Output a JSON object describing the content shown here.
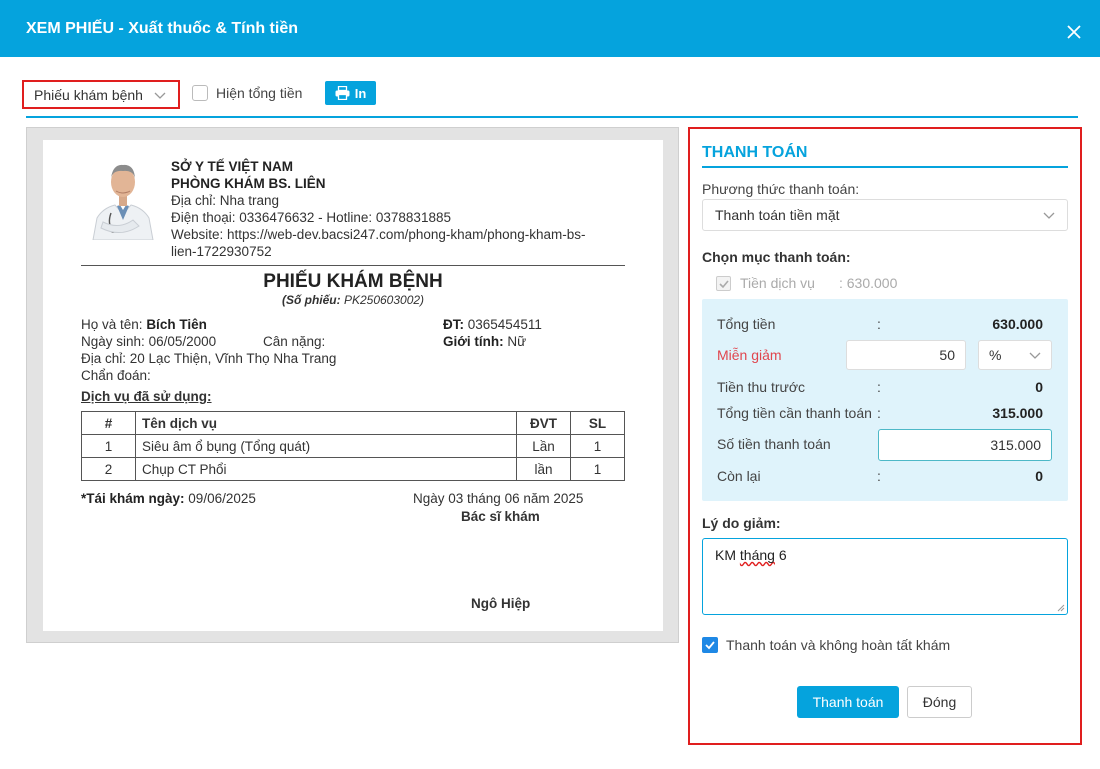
{
  "window": {
    "title": "XEM PHIẾU - Xuất thuốc & Tính tiền",
    "close_icon": "close-icon"
  },
  "toolbar": {
    "form_select": "Phiếu khám bệnh",
    "show_total_label": "Hiện tổng tiền",
    "show_total_checked": false,
    "print_label": "In"
  },
  "document": {
    "org": "SỞ Y TẾ VIỆT NAM",
    "clinic_name": "PHÒNG KHÁM BS. LIÊN",
    "address": "Địa chỉ: Nha trang",
    "phone": "Điện thoại: 0336476632 - Hotline: 0378831885",
    "website_line1": "Website: https://web-dev.bacsi247.com/phong-kham/phong-kham-bs-",
    "website_line2": "lien-1722930752",
    "title": "PHIẾU KHÁM BỆNH",
    "code_label": "(Số phiếu:",
    "code_value": "PK250603002)",
    "patient": {
      "name_label": "Họ và tên:",
      "name": "Bích Tiên",
      "phone_label": "ĐT:",
      "phone": "0365454511",
      "dob_label": "Ngày sinh:",
      "dob": "06/05/2000",
      "weight_label": "Cân nặng:",
      "gender_label": "Giới tính:",
      "gender": "Nữ",
      "address_label": "Địa chỉ:",
      "address": "20 Lạc Thiện, Vĩnh Thọ Nha Trang",
      "diagnosis_label": "Chẩn đoán:"
    },
    "services_title": "Dịch vụ đã sử dụng:",
    "table": {
      "headers": [
        "#",
        "Tên dịch vụ",
        "ĐVT",
        "SL"
      ],
      "rows": [
        [
          "1",
          "Siêu âm ổ bụng (Tổng quát)",
          "Lần",
          "1"
        ],
        [
          "2",
          "Chụp CT Phổi",
          "lần",
          "1"
        ]
      ]
    },
    "revisit_label": "*Tái khám ngày:",
    "revisit_date": "09/06/2025",
    "date_line": "Ngày 03 tháng 06 năm 2025",
    "doctor_title": "Bác sĩ khám",
    "doctor_name": "Ngô Hiệp"
  },
  "payment": {
    "title": "THANH TOÁN",
    "method_label": "Phương thức thanh toán:",
    "method_value": "Thanh toán tiền mặt",
    "choose_label": "Chọn mục thanh toán:",
    "service_item_label": "Tiền dịch vụ",
    "service_item_amount": ": 630.000",
    "total_label": "Tổng tiền",
    "total_value": "630.000",
    "discount_label": "Miễn giảm",
    "discount_value": "50",
    "discount_unit": "%",
    "prepaid_label": "Tiền thu trước",
    "prepaid_value": "0",
    "due_label": "Tổng tiền cần thanh toán",
    "due_value": "315.000",
    "pay_label": "Số tiền thanh toán",
    "pay_value": "315.000",
    "remain_label": "Còn lại",
    "remain_value": "0",
    "colon": ":",
    "reason_label": "Lý do giảm:",
    "reason_text_a": "KM ",
    "reason_text_b": "tháng",
    "reason_text_c": " 6",
    "complete_label": "Thanh toán và không hoàn tất khám",
    "complete_checked": true,
    "pay_button": "Thanh toán",
    "close_button": "Đóng"
  },
  "colors": {
    "accent": "#05a3dd",
    "highlight": "#e01e1e",
    "calc_bg": "#dff3fb",
    "discount_label": "#e0454d"
  }
}
